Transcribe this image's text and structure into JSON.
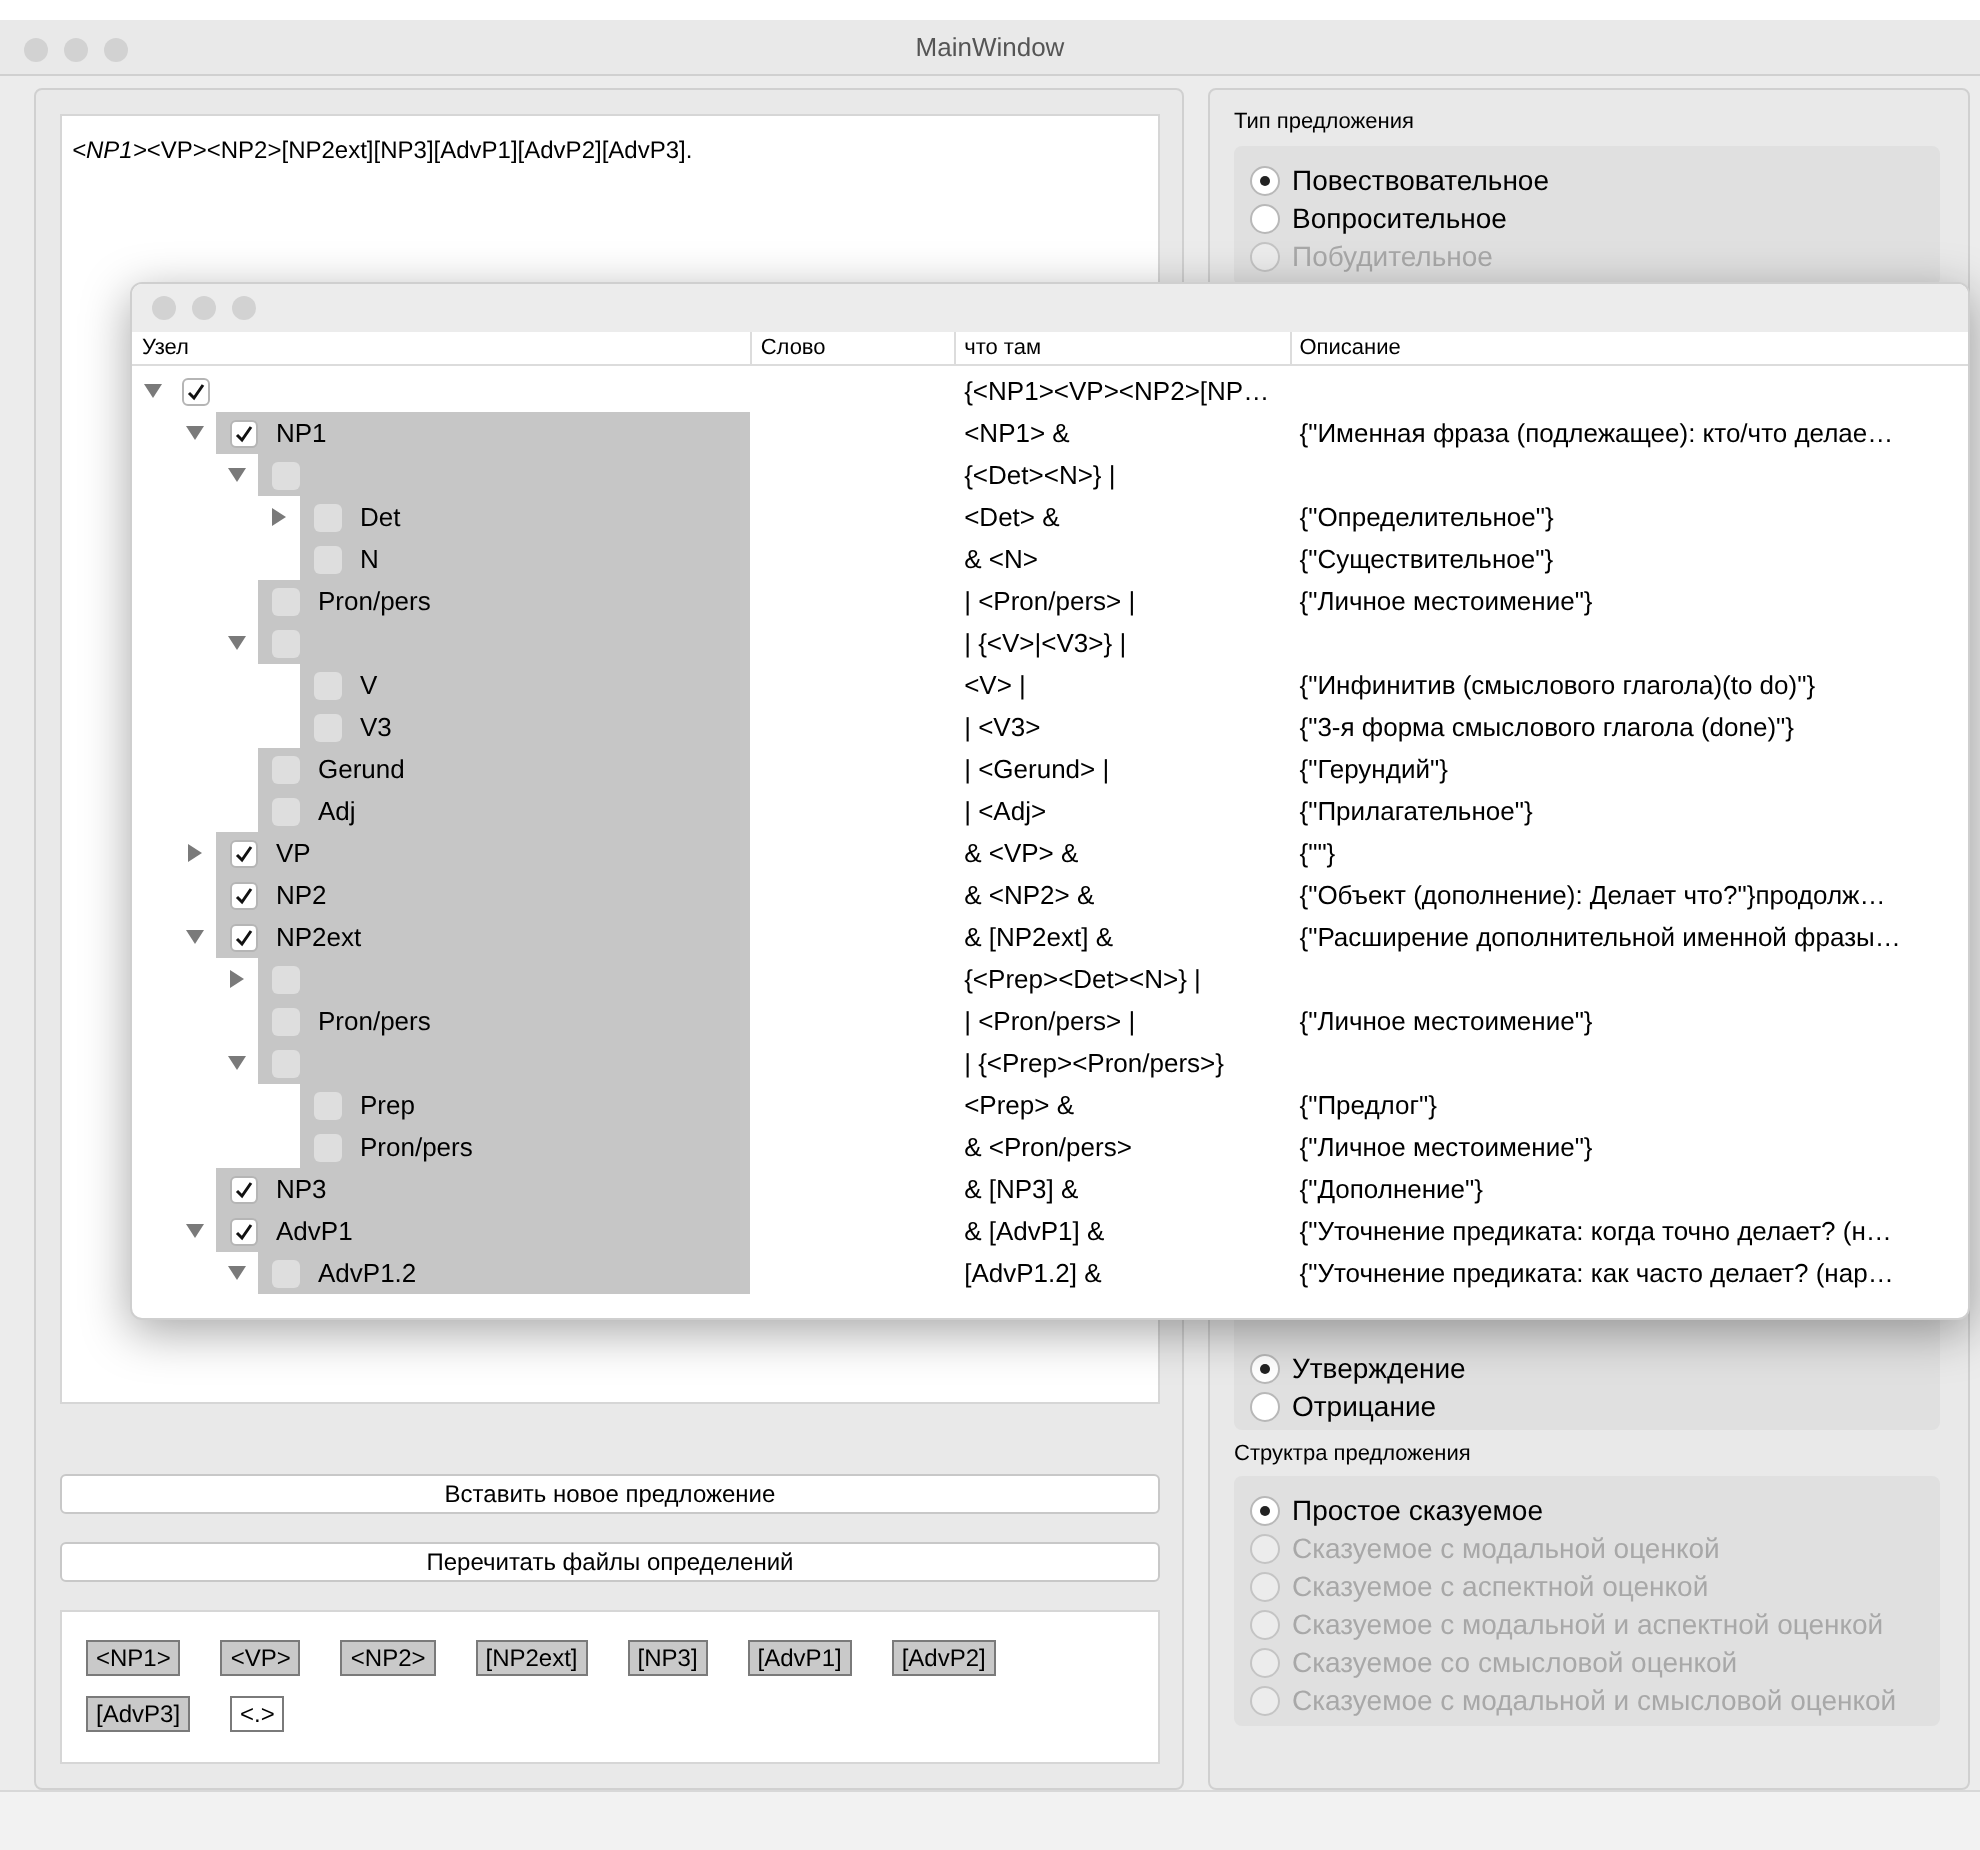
{
  "window": {
    "title": "MainWindow"
  },
  "editor": {
    "text": "*<NP1>*<VP><NP2>[NP2ext][NP3][AdvP1][AdvP2][AdvP3]."
  },
  "buttons": [
    "Вставить новое предложение",
    "Перечитать файлы определений"
  ],
  "tags": [
    {
      "label": "<NP1>",
      "active": true
    },
    {
      "label": "<VP>",
      "active": true
    },
    {
      "label": "<NP2>",
      "active": true
    },
    {
      "label": "[NP2ext]",
      "active": true
    },
    {
      "label": "[NP3]",
      "active": true
    },
    {
      "label": "[AdvP1]",
      "active": true
    },
    {
      "label": "[AdvP2]",
      "active": true
    },
    {
      "label": "[AdvP3]",
      "active": true
    },
    {
      "label": "<.>",
      "active": false
    }
  ],
  "groups": [
    {
      "title": "Тип предложения",
      "options": [
        {
          "label": "Повествовательное",
          "selected": true,
          "disabled": false
        },
        {
          "label": "Вопросительное",
          "selected": false,
          "disabled": false
        },
        {
          "label": "Побудительное",
          "selected": false,
          "disabled": true
        }
      ]
    },
    {
      "options": [
        {
          "label": "Утверждение",
          "selected": true,
          "disabled": false
        },
        {
          "label": "Отрицание",
          "selected": false,
          "disabled": false
        }
      ]
    },
    {
      "title": "Структра предложения",
      "options": [
        {
          "label": "Простое сказуемое",
          "selected": true,
          "disabled": false
        },
        {
          "label": "Сказуемое с модальной оценкой",
          "selected": false,
          "disabled": true
        },
        {
          "label": "Сказуемое с аспектной оценкой",
          "selected": false,
          "disabled": true
        },
        {
          "label": "Сказуемое с модальной и аспектной оценкой",
          "selected": false,
          "disabled": true
        },
        {
          "label": "Сказуемое со смысловой оценкой",
          "selected": false,
          "disabled": true
        },
        {
          "label": "Сказуемое с модальной и смысловой оценкой",
          "selected": false,
          "disabled": true
        }
      ]
    }
  ],
  "tree_window": {
    "columns": [
      "Узел",
      "Слово",
      "что там",
      "Описание"
    ],
    "tree": [
      {
        "checked": true,
        "expandable": true,
        "expanded": true,
        "what": "{<NP1><VP><NP2>[NP…",
        "children": [
          {
            "label": "NP1",
            "checked": true,
            "expandable": true,
            "expanded": true,
            "what": "<NP1> &",
            "description": "{\"Именная фраза (подлежащее): кто/что делае…",
            "children": [
              {
                "checked": false,
                "expandable": true,
                "expanded": true,
                "what": "{<Det><N>} |",
                "children": [
                  {
                    "label": "Det",
                    "checked": false,
                    "expandable": true,
                    "expanded": false,
                    "what": "<Det> &",
                    "description": "{\"Определительное\"}"
                  },
                  {
                    "label": "N",
                    "checked": false,
                    "expandable": false,
                    "what": "& <N>",
                    "description": "{\"Существительное\"}"
                  }
                ]
              },
              {
                "label": "Pron/pers",
                "checked": false,
                "expandable": false,
                "what": "| <Pron/pers> |",
                "description": "{\"Личное местоимение\"}"
              },
              {
                "checked": false,
                "expandable": true,
                "expanded": true,
                "what": "| {<V>|<V3>} |",
                "children": [
                  {
                    "label": "V",
                    "checked": false,
                    "expandable": false,
                    "what": "<V> |",
                    "description": "{\"Инфинитив (смыслового глагола)(to do)\"}"
                  },
                  {
                    "label": "V3",
                    "checked": false,
                    "expandable": false,
                    "what": "| <V3>",
                    "description": "{\"3-я форма смыслового глагола (done)\"}"
                  }
                ]
              },
              {
                "label": "Gerund",
                "checked": false,
                "expandable": false,
                "what": "| <Gerund> |",
                "description": "{\"Герундий\"}"
              },
              {
                "label": "Adj",
                "checked": false,
                "expandable": false,
                "what": "| <Adj>",
                "description": "{\"Прилагательное\"}"
              }
            ]
          },
          {
            "label": "VP",
            "checked": true,
            "expandable": true,
            "expanded": false,
            "what": "& <VP> &",
            "description": "{\"\"}"
          },
          {
            "label": "NP2",
            "checked": true,
            "expandable": false,
            "what": "& <NP2> &",
            "description": "{\"Объект (дополнение): Делает что?\"}продолж…"
          },
          {
            "label": "NP2ext",
            "checked": true,
            "expandable": true,
            "expanded": true,
            "what": "& [NP2ext] &",
            "description": "{\"Расширение дополнительной именной фразы…",
            "children": [
              {
                "checked": false,
                "expandable": true,
                "expanded": false,
                "what": "{<Prep><Det><N>} |"
              },
              {
                "label": "Pron/pers",
                "checked": false,
                "expandable": false,
                "what": "| <Pron/pers> |",
                "description": "{\"Личное местоимение\"}"
              },
              {
                "checked": false,
                "expandable": true,
                "expanded": true,
                "what": "| {<Prep><Pron/pers>}",
                "children": [
                  {
                    "label": "Prep",
                    "checked": false,
                    "expandable": false,
                    "what": "<Prep> &",
                    "description": "{\"Предлог\"}"
                  },
                  {
                    "label": "Pron/pers",
                    "checked": false,
                    "expandable": false,
                    "what": "& <Pron/pers>",
                    "description": "{\"Личное местоимение\"}"
                  }
                ]
              }
            ]
          },
          {
            "label": "NP3",
            "checked": true,
            "expandable": false,
            "what": "& [NP3] &",
            "description": "{\"Дополнение\"}"
          },
          {
            "label": "AdvP1",
            "checked": true,
            "expandable": true,
            "expanded": true,
            "what": "& [AdvP1] &",
            "description": "{\"Уточнение предиката: когда точно делает? (н…",
            "children": [
              {
                "label": "AdvP1.2",
                "checked": false,
                "expandable": true,
                "expanded": true,
                "what": "[AdvP1.2] &",
                "description": "{\"Уточнение предиката: как часто делает? (нар…"
              }
            ]
          }
        ]
      }
    ]
  }
}
